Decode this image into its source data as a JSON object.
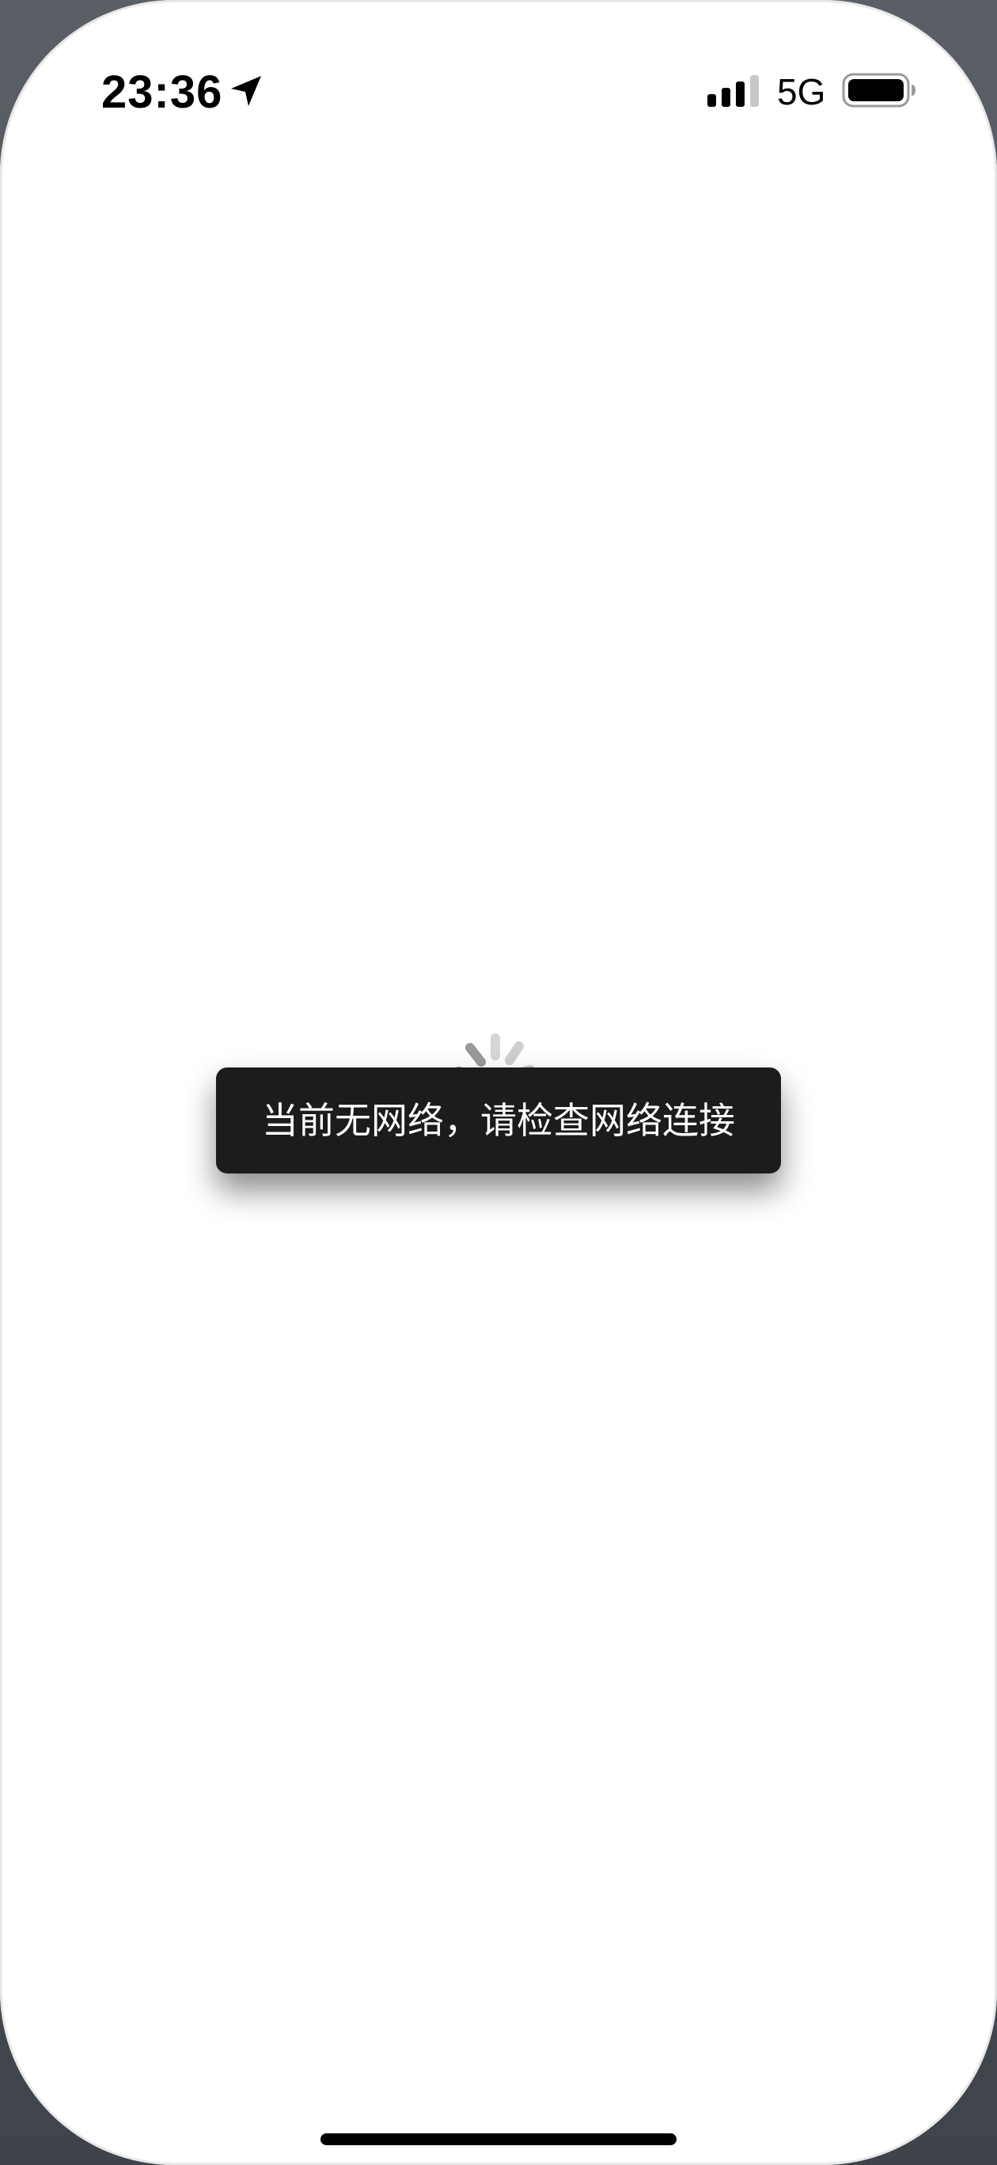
{
  "status_bar": {
    "time": "23:36",
    "network": "5G",
    "signal_bars": 3,
    "signal_bars_total": 4,
    "battery_level": 1.0,
    "icons": [
      "location-arrow-icon",
      "signal-icon",
      "battery-icon"
    ]
  },
  "loading": {
    "icon": "spinner-icon"
  },
  "toast": {
    "message": "当前无网络，请检查网络连接"
  },
  "colors": {
    "toast_background": "#1c1c1c",
    "toast_text": "#ffffff",
    "screen_background": "#ffffff"
  }
}
